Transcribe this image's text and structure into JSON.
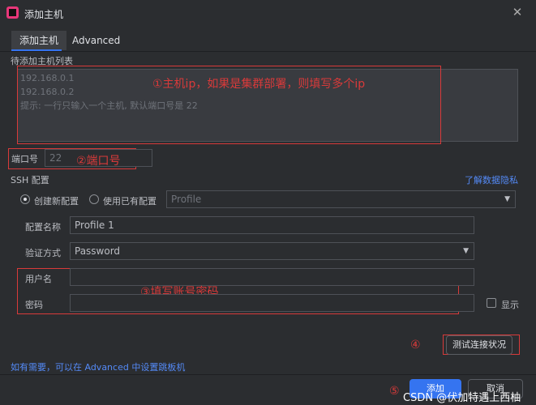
{
  "window": {
    "title": "添加主机"
  },
  "tabs": [
    {
      "label": "添加主机"
    },
    {
      "label": "Advanced"
    }
  ],
  "hosts": {
    "section_label": "待添加主机列表",
    "lines": [
      "192.168.0.1",
      "192.168.0.2",
      "提示: 一行只输入一个主机, 默认端口号是 22"
    ]
  },
  "port": {
    "label": "端口号",
    "value": "22"
  },
  "ssh": {
    "section_label": "SSH 配置",
    "privacy_link": "了解数据隐私",
    "radio_new": "创建新配置",
    "radio_existing": "使用已有配置",
    "existing_profile": "Profile",
    "config_name_label": "配置名称",
    "config_name_value": "Profile 1",
    "auth_label": "验证方式",
    "auth_value": "Password",
    "username_label": "用户名",
    "password_label": "密码",
    "show_label": "显示"
  },
  "annotations": {
    "a1": "①主机ip，如果是集群部署，则填写多个ip",
    "a2": "②端口号",
    "a3": "③填写账号密码",
    "a4": "④",
    "a5": "⑤"
  },
  "test_button": "测试连接状况",
  "advanced_hint": "如有需要，可以在 Advanced 中设置跳板机",
  "footer": {
    "add": "添加",
    "cancel": "取消"
  },
  "watermark": "CSDN @伏加特遇上西柚",
  "colors": {
    "accent": "#3574f0",
    "annotation": "#d93a3a",
    "link": "#548af7"
  }
}
